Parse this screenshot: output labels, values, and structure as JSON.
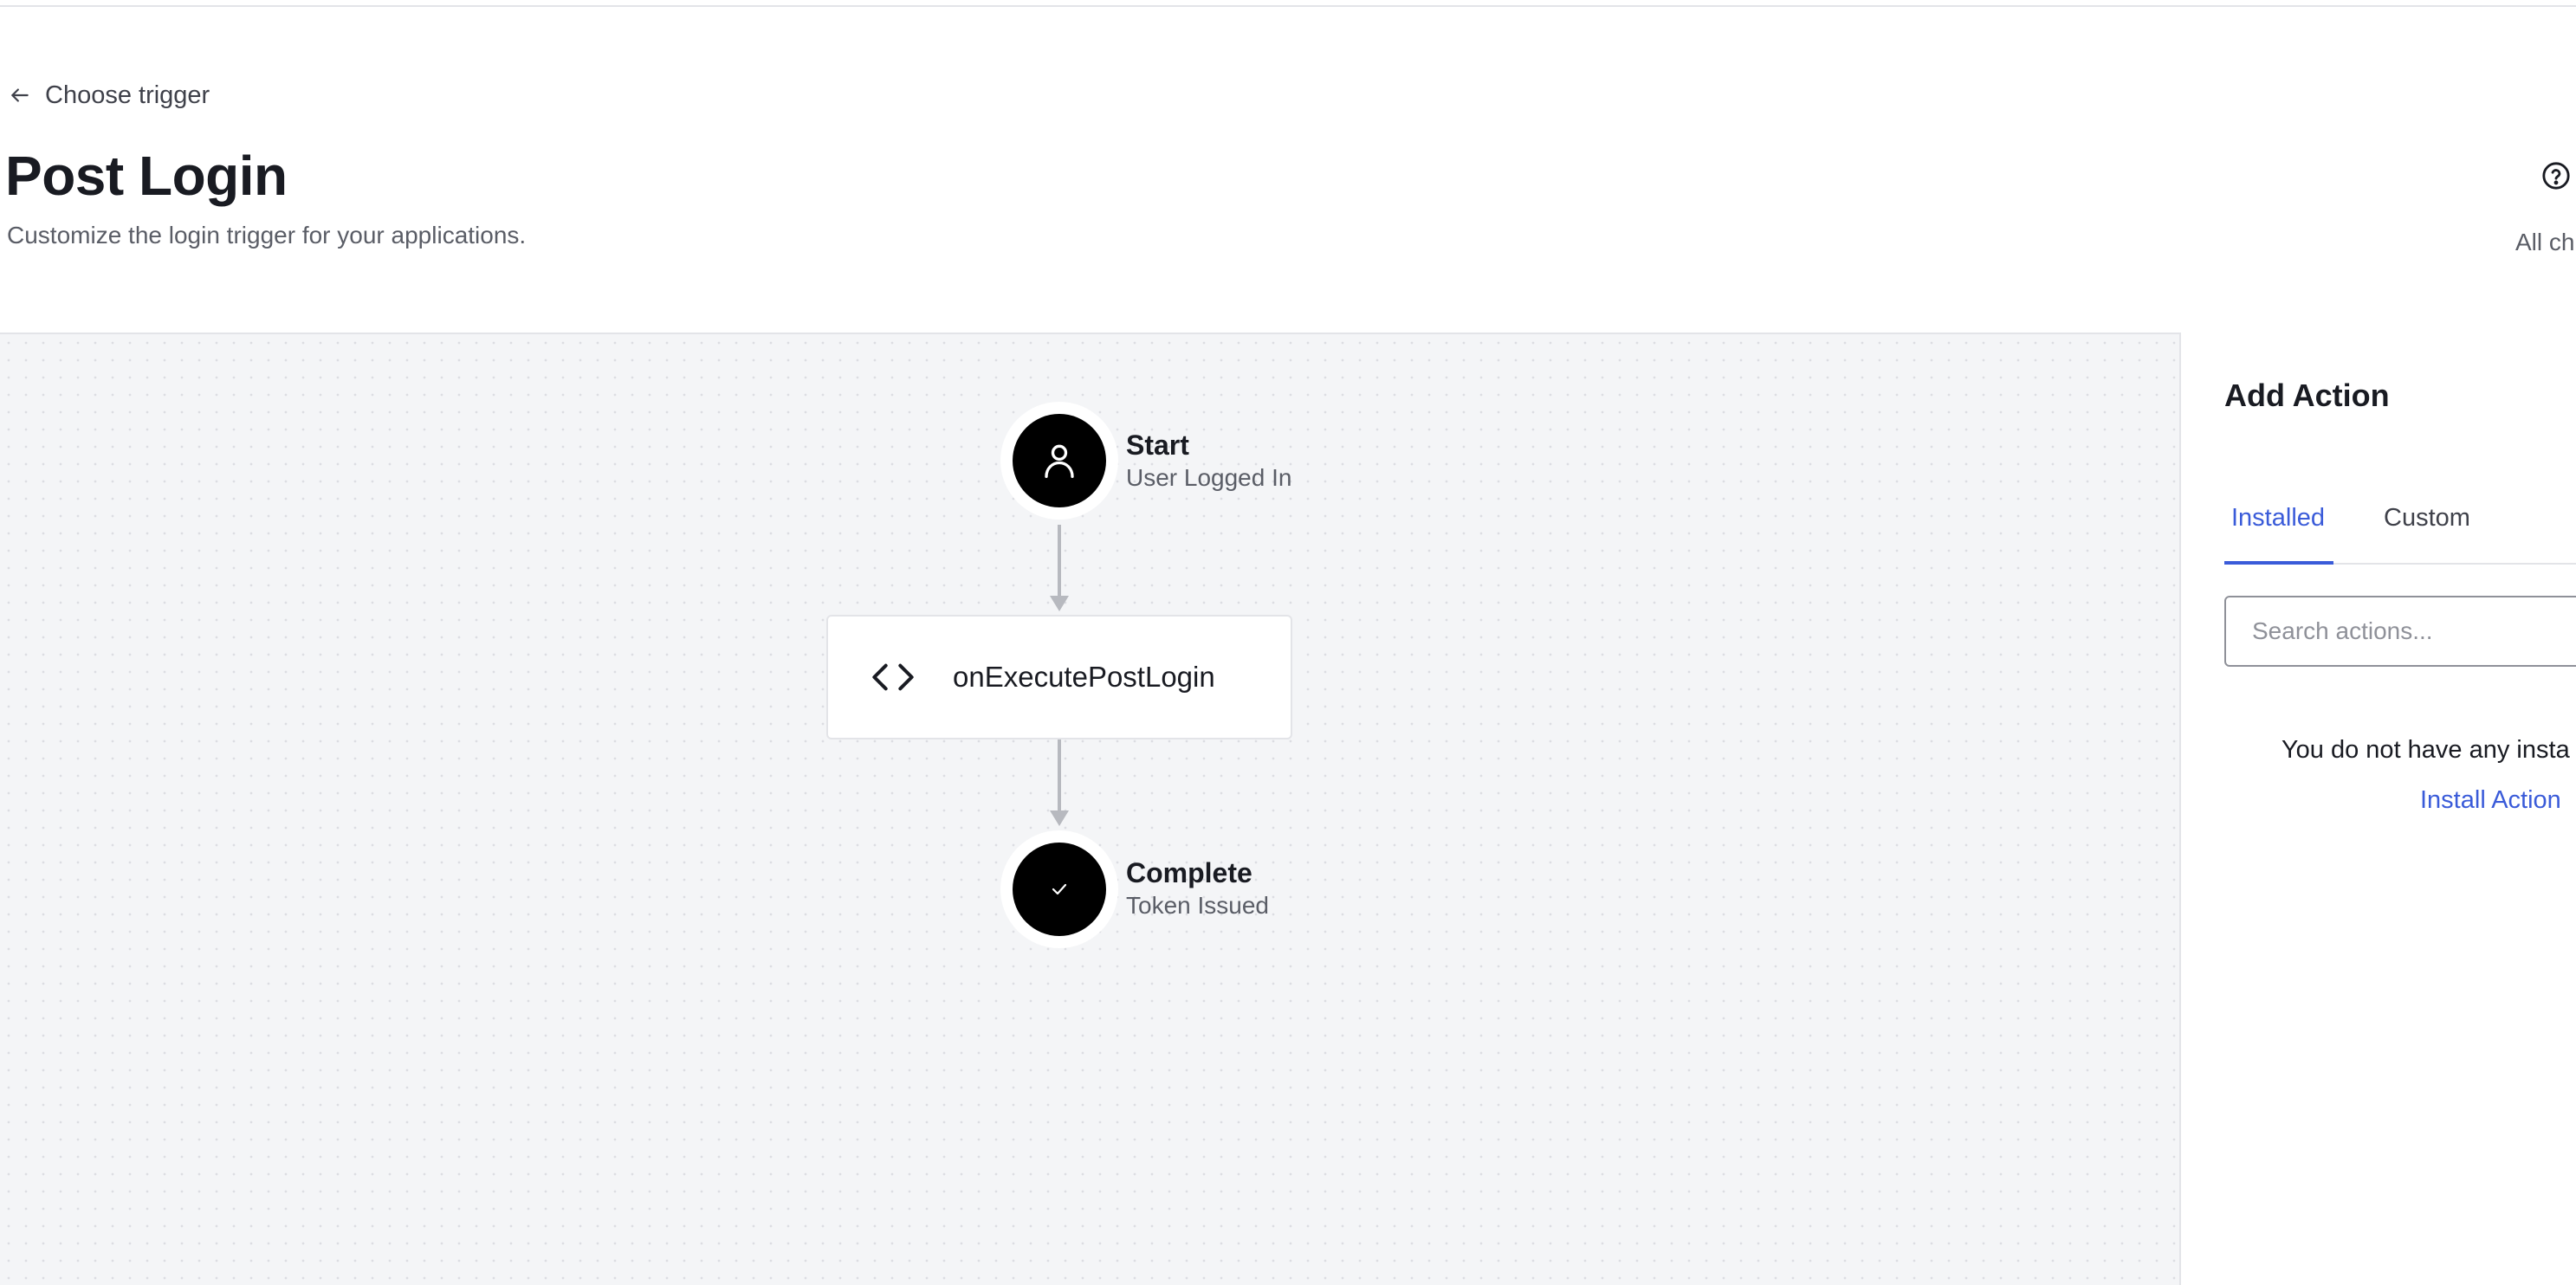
{
  "header": {
    "back_label": "Choose trigger",
    "title": "Post Login",
    "subtitle": "Customize the login trigger for your applications.",
    "status_truncated": "All ch"
  },
  "flow": {
    "start": {
      "title": "Start",
      "subtitle": "User Logged In",
      "icon": "user-icon"
    },
    "action": {
      "name": "onExecutePostLogin",
      "icon": "code-icon"
    },
    "complete": {
      "title": "Complete",
      "subtitle": "Token Issued",
      "icon": "check-icon"
    }
  },
  "panel": {
    "title": "Add Action",
    "tabs": [
      {
        "label": "Installed",
        "active": true
      },
      {
        "label": "Custom",
        "active": false
      }
    ],
    "search_placeholder": "Search actions...",
    "empty_message": "You do not have any insta",
    "install_link": "Install Action"
  },
  "colors": {
    "accent": "#3a5bd9",
    "canvas_bg": "#f4f5f7",
    "node_fill": "#000000",
    "connector": "#b7b9bf"
  }
}
